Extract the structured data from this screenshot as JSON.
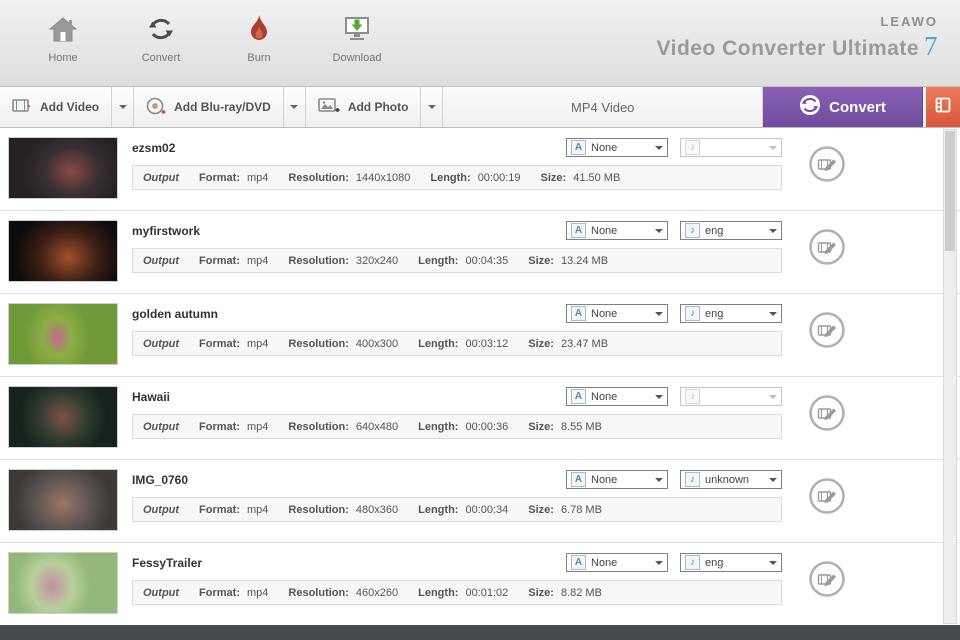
{
  "app": {
    "brand": "LEAWO",
    "title": "Video Converter Ultimate",
    "version": "7"
  },
  "nav": {
    "items": [
      {
        "label": "Home"
      },
      {
        "label": "Convert"
      },
      {
        "label": "Burn"
      },
      {
        "label": "Download"
      }
    ]
  },
  "toolbar": {
    "add_video": "Add Video",
    "add_bluray": "Add Blu-ray/DVD",
    "add_photo": "Add Photo",
    "format_selected": "MP4 Video",
    "convert_label": "Convert"
  },
  "row_labels": {
    "output": "Output",
    "format": "Format:",
    "resolution": "Resolution:",
    "length": "Length:",
    "size": "Size:"
  },
  "icons": {
    "subtitle_badge": "A",
    "audio_note": "♪"
  },
  "items": [
    {
      "title": "ezsm02",
      "format": "mp4",
      "resolution": "1440x1080",
      "length": "00:00:19",
      "size": "41.50 MB",
      "subtitle": "None",
      "audio": ""
    },
    {
      "title": "myfirstwork",
      "format": "mp4",
      "resolution": "320x240",
      "length": "00:04:35",
      "size": "13.24 MB",
      "subtitle": "None",
      "audio": "eng"
    },
    {
      "title": "golden autumn",
      "format": "mp4",
      "resolution": "400x300",
      "length": "00:03:12",
      "size": "23.47 MB",
      "subtitle": "None",
      "audio": "eng"
    },
    {
      "title": "Hawaii",
      "format": "mp4",
      "resolution": "640x480",
      "length": "00:00:36",
      "size": "8.55 MB",
      "subtitle": "None",
      "audio": ""
    },
    {
      "title": "IMG_0760",
      "format": "mp4",
      "resolution": "480x360",
      "length": "00:00:34",
      "size": "6.78 MB",
      "subtitle": "None",
      "audio": "unknown"
    },
    {
      "title": "FessyTrailer",
      "format": "mp4",
      "resolution": "460x260",
      "length": "00:01:02",
      "size": "8.82 MB",
      "subtitle": "None",
      "audio": "eng"
    }
  ],
  "colors": {
    "accent_blue": "#3fa9de",
    "convert_purple": "#6d4c9d",
    "burn_red": "#a8402f",
    "download_green": "#5aa832",
    "side_button_orange": "#e2604a"
  }
}
